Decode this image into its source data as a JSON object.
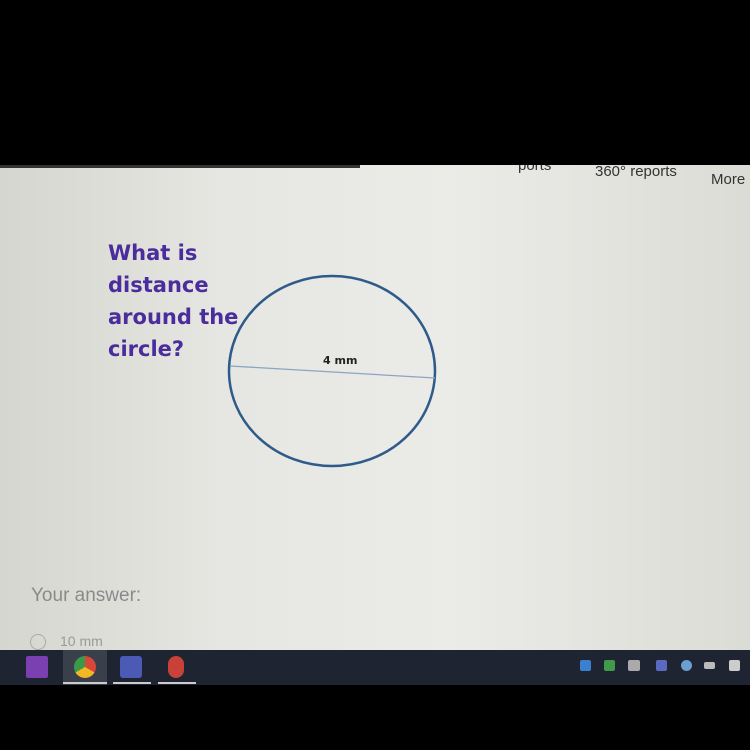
{
  "nav": {
    "partial_item": "ports",
    "reports": "360° reports",
    "more": "More"
  },
  "question": {
    "lines": [
      "What is",
      "distance",
      "around the",
      "circle?"
    ]
  },
  "diagram": {
    "diameter_label": "4 mm",
    "circle_color": "#2e5b8a"
  },
  "answer": {
    "label": "Your answer:",
    "options": [
      "10 mm"
    ]
  },
  "taskbar": {
    "apps": [
      "onenote-icon",
      "chrome-icon",
      "teams-icon",
      "snipping-tool-icon"
    ]
  },
  "colors": {
    "question_text": "#4a2c9c",
    "taskbar": "#1f2433"
  }
}
